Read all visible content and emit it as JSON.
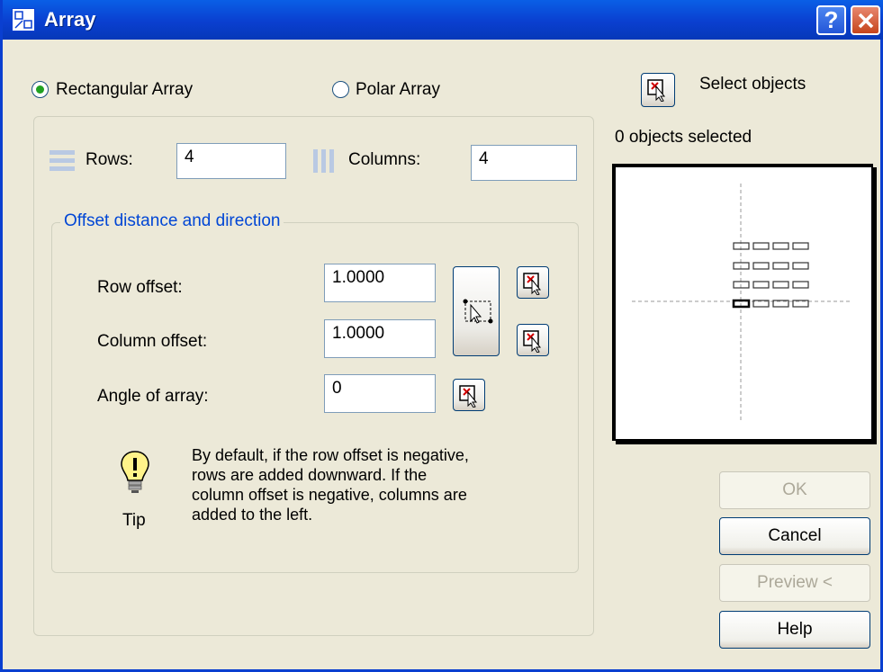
{
  "window": {
    "title": "Array"
  },
  "array_type": {
    "rectangular_label": "Rectangular Array",
    "polar_label": "Polar Array",
    "selected": "rectangular"
  },
  "select_objects": {
    "label": "Select objects",
    "status": "0 objects selected"
  },
  "grid": {
    "rows_label": "Rows:",
    "rows_value": "4",
    "columns_label": "Columns:",
    "columns_value": "4"
  },
  "offset": {
    "legend": "Offset distance and direction",
    "row_offset_label": "Row offset:",
    "row_offset_value": "1.0000",
    "column_offset_label": "Column offset:",
    "column_offset_value": "1.0000",
    "angle_label": "Angle of array:",
    "angle_value": "0"
  },
  "tip": {
    "label": "Tip",
    "lines": [
      "By default, if the row offset is negative,",
      "rows are added downward.  If the",
      "column offset is negative, columns are",
      "added to the left."
    ]
  },
  "buttons": {
    "ok": "OK",
    "cancel": "Cancel",
    "preview": "Preview <",
    "help": "Help"
  },
  "colors": {
    "titlebar": "#0A3FD0",
    "dialog_bg": "#ECE9D8",
    "group_legend": "#0046D5",
    "radio_selected": "#21A121"
  }
}
